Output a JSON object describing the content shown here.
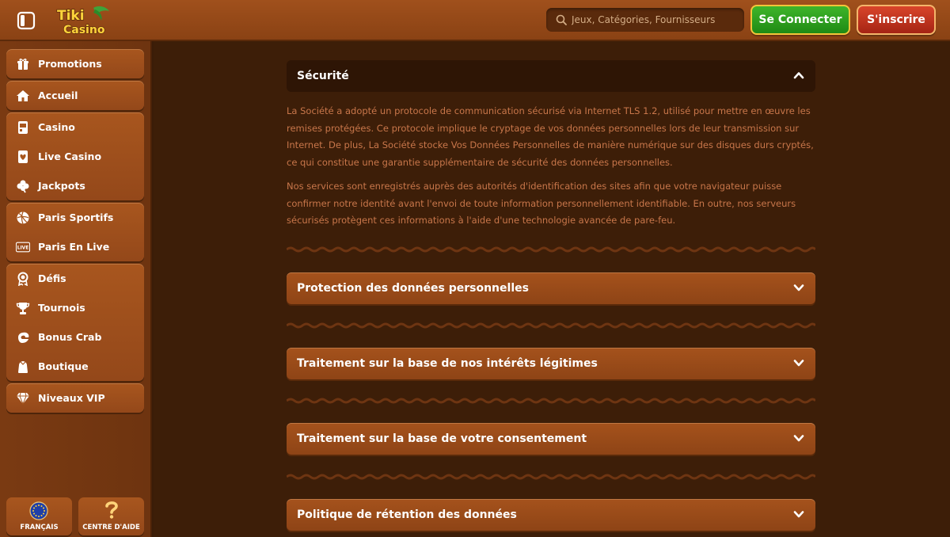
{
  "header": {
    "logo_line1": "Tiki",
    "logo_line2": "Casino",
    "search_placeholder": "Jeux, Catégories, Fournisseurs",
    "login_label": "Se Connecter",
    "signup_label": "S'inscrire"
  },
  "sidebar": {
    "groups": [
      {
        "items": [
          {
            "label": "Promotions",
            "icon": "gift-icon"
          }
        ]
      },
      {
        "items": [
          {
            "label": "Accueil",
            "icon": "home-icon"
          }
        ]
      },
      {
        "items": [
          {
            "label": "Casino",
            "icon": "slot-machine-icon"
          },
          {
            "label": "Live Casino",
            "icon": "card-heart-icon"
          },
          {
            "label": "Jackpots",
            "icon": "clover-icon"
          }
        ]
      },
      {
        "items": [
          {
            "label": "Paris Sportifs",
            "icon": "ball-icon"
          },
          {
            "label": "Paris En Live",
            "icon": "live-icon"
          }
        ]
      },
      {
        "items": [
          {
            "label": "Défis",
            "icon": "medal-icon"
          },
          {
            "label": "Tournois",
            "icon": "trophy-icon"
          },
          {
            "label": "Bonus Crab",
            "icon": "crab-icon"
          },
          {
            "label": "Boutique",
            "icon": "bag-icon"
          }
        ]
      },
      {
        "items": [
          {
            "label": "Niveaux VIP",
            "icon": "diamond-icon"
          }
        ]
      }
    ],
    "language_label": "FRANÇAIS",
    "help_label": "CENTRE D'AIDE",
    "live_badge": "LIVE"
  },
  "main": {
    "open_section": {
      "title": "Sécurité",
      "paragraphs": [
        "La Société a adopté un protocole de communication sécurisé via Internet TLS 1.2, utilisé pour mettre en œuvre les remises protégées. Ce protocole implique le cryptage de vos données personnelles lors de leur transmission sur Internet. De plus, La Société stocke Vos Données Personnelles de manière numérique sur des disques durs cryptés, ce qui constitue une garantie supplémentaire de sécurité des données personnelles.",
        "Nos services sont enregistrés auprès des autorités d'identification des sites afin que votre navigateur puisse confirmer notre identité avant l'envoi de toute information personnellement identifiable. En outre, nos serveurs sécurisés protègent ces informations à l'aide d'une technologie avancée de pare-feu."
      ]
    },
    "sections": [
      {
        "title": "Protection des données personnelles"
      },
      {
        "title": "Traitement sur la base de nos intérêts légitimes"
      },
      {
        "title": "Traitement sur la base de votre consentement"
      },
      {
        "title": "Politique de rétention des données"
      }
    ]
  },
  "colors": {
    "accent_green": "#2fa01e",
    "accent_red": "#c0341e",
    "body_text": "#c8764a",
    "wood": "#a5521c"
  }
}
